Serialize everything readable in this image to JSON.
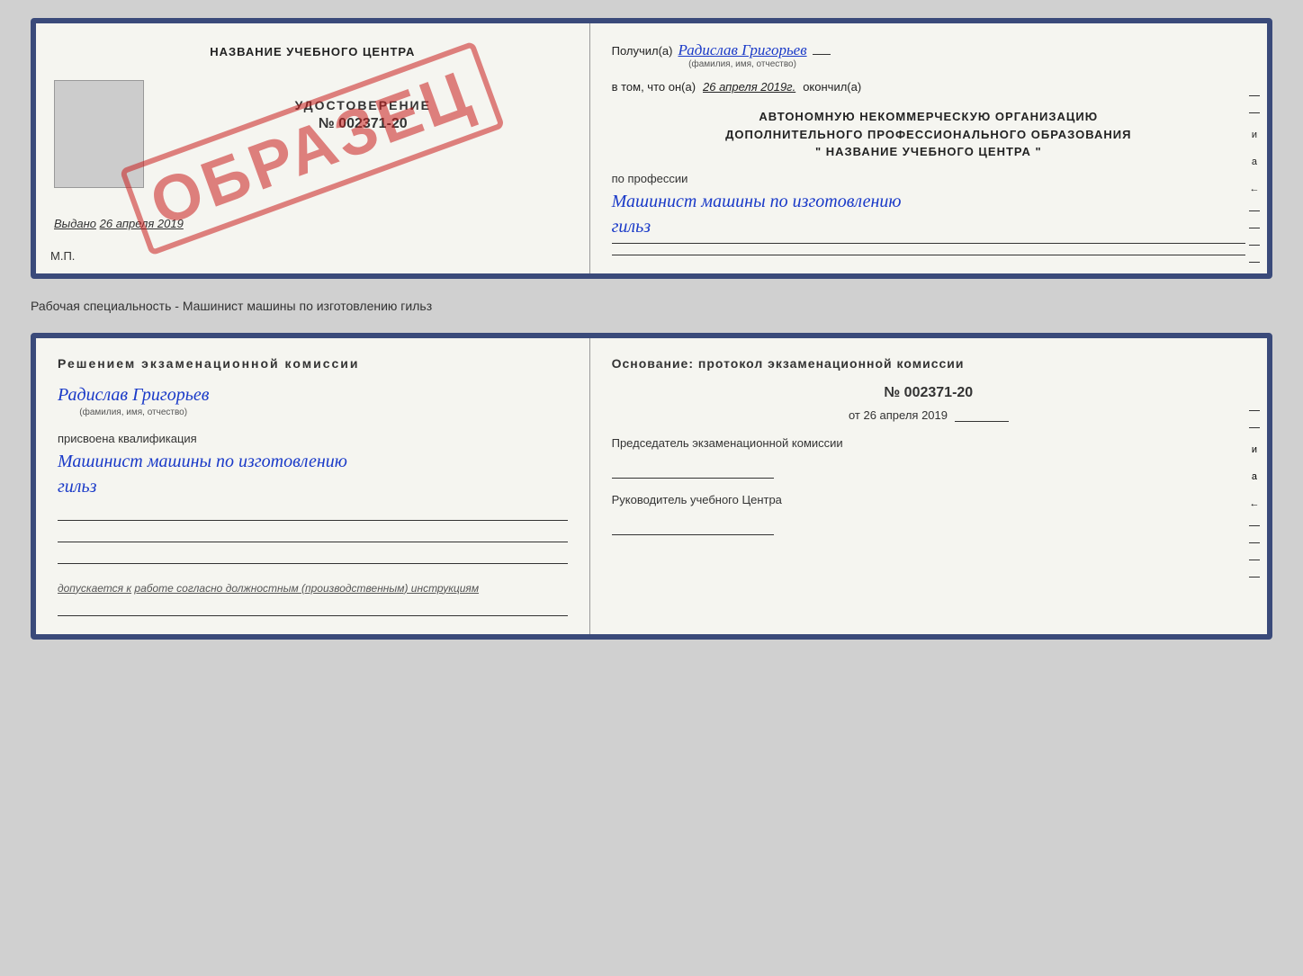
{
  "page": {
    "background_color": "#d0d0d0"
  },
  "top_document": {
    "left": {
      "learning_center_title": "НАЗВАНИЕ УЧЕБНОГО ЦЕНТРА",
      "cert_label": "УДОСТОВЕРЕНИЕ",
      "cert_number": "№ 002371-20",
      "issued_prefix": "Выдано",
      "issued_date": "26 апреля 2019",
      "mp_label": "М.П.",
      "stamp_text": "ОБРАЗЕЦ"
    },
    "right": {
      "received_prefix": "Получил(а)",
      "received_name": "Радислав Григорьев",
      "name_sublabel": "(фамилия, имя, отчество)",
      "date_prefix": "в том, что он(а)",
      "date_value": "26 апреля 2019г.",
      "date_suffix": "окончил(а)",
      "org_line1": "АВТОНОМНУЮ НЕКОММЕРЧЕСКУЮ ОРГАНИЗАЦИЮ",
      "org_line2": "ДОПОЛНИТЕЛЬНОГО ПРОФЕССИОНАЛЬНОГО ОБРАЗОВАНИЯ",
      "org_line3": "\"  НАЗВАНИЕ УЧЕБНОГО ЦЕНТРА  \"",
      "profession_prefix": "по профессии",
      "profession_name_line1": "Машинист машины по изготовлению",
      "profession_name_line2": "гильз",
      "side_text_и": "и",
      "side_text_а": "а",
      "side_text_arrow": "←"
    }
  },
  "separator": {
    "text": "Рабочая специальность - Машинист машины по изготовлению гильз"
  },
  "bottom_document": {
    "left": {
      "commission_title": "Решением  экзаменационной  комиссии",
      "person_name": "Радислав Григорьев",
      "name_sublabel": "(фамилия, имя, отчество)",
      "qualification_prefix": "присвоена квалификация",
      "qualification_name_line1": "Машинист машины по изготовлению",
      "qualification_name_line2": "гильз",
      "work_permission_prefix": "допускается к",
      "work_permission_text": "работе согласно должностным (производственным) инструкциям"
    },
    "right": {
      "basis_title": "Основание: протокол экзаменационной  комиссии",
      "protocol_number": "№  002371-20",
      "protocol_date_prefix": "от",
      "protocol_date": "26 апреля 2019",
      "chairman_label": "Председатель экзаменационной комиссии",
      "director_label": "Руководитель учебного Центра",
      "side_text_и": "и",
      "side_text_а": "а",
      "side_text_arrow": "←"
    }
  }
}
